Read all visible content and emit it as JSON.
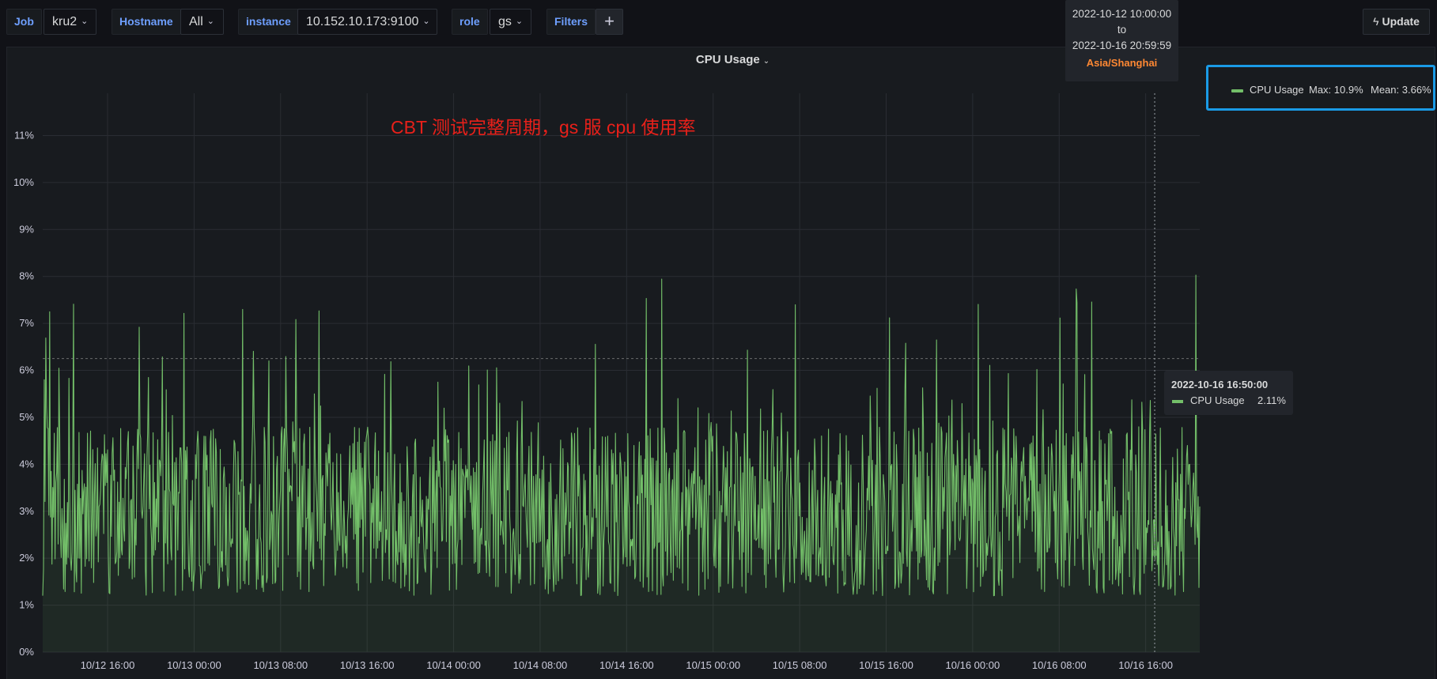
{
  "variables": {
    "job": {
      "label": "Job",
      "value": "kru2"
    },
    "hostname": {
      "label": "Hostname",
      "value": "All"
    },
    "instance": {
      "label": "instance",
      "value": "10.152.10.173:9100"
    },
    "role": {
      "label": "role",
      "value": "gs"
    },
    "filters_label": "Filters",
    "add_label": "+"
  },
  "update_label": "Update",
  "time_range": {
    "from": "2022-10-12 10:00:00",
    "to_word": "to",
    "to": "2022-10-16 20:59:59",
    "timezone": "Asia/Shanghai"
  },
  "panel": {
    "title": "CPU Usage"
  },
  "annotation": "CBT 测试完整周期，gs 服 cpu 使用率",
  "legend": {
    "name": "CPU Usage",
    "max": "Max: 10.9%",
    "mean": "Mean: 3.66%"
  },
  "tooltip": {
    "time": "2022-10-16 16:50:00",
    "series": "CPU Usage",
    "value": "2.11%"
  },
  "colors": {
    "series": "#73bf69",
    "annotation": "#e8201a",
    "link": "#6e9fff",
    "timezone": "#ff8833",
    "selection_border": "#1a9be6"
  },
  "chart_data": {
    "type": "line",
    "series": [
      {
        "name": "CPU Usage",
        "max": 10.9,
        "mean": 3.66,
        "tooltip_point": {
          "x": "2022-10-16 16:50:00",
          "y": 2.11
        }
      }
    ],
    "x_start": "2022-10-12 10:00:00",
    "x_end": "2022-10-16 20:59:59",
    "x_ticks": [
      "10/12 16:00",
      "10/13 00:00",
      "10/13 08:00",
      "10/13 16:00",
      "10/14 00:00",
      "10/14 08:00",
      "10/14 16:00",
      "10/15 00:00",
      "10/15 08:00",
      "10/15 16:00",
      "10/16 00:00",
      "10/16 08:00",
      "10/16 16:00"
    ],
    "y_ticks": [
      "0%",
      "1%",
      "2%",
      "3%",
      "4%",
      "5%",
      "6%",
      "7%",
      "8%",
      "9%",
      "10%",
      "11%"
    ],
    "ylim": [
      0,
      11.9
    ],
    "threshold_line": 6.25,
    "grid": true,
    "legend_position": "right"
  }
}
